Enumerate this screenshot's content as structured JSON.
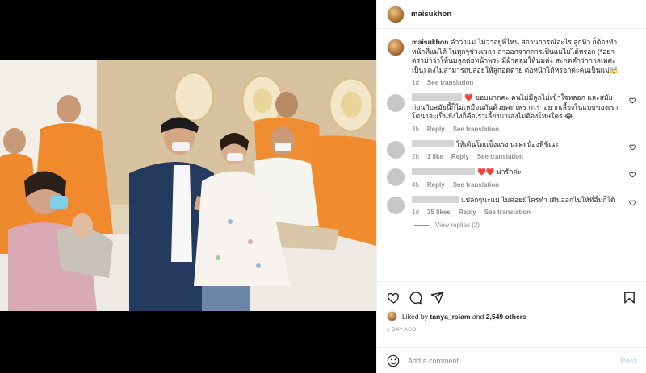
{
  "header": {
    "username": "maisukhon"
  },
  "caption": {
    "username": "maisukhon",
    "text": "คำว่าแม่ ไม่ว่าอยู่ที่ไหน สถานการณ์อะไร ลูกหิว ก็ต้องทำหน้าที่แม่ได้ ในทุกๆช่วงเวลา ลาออกจากการเป็นแม่ไม่ได้หรอก (*อย่าดราม่าว่าให้นมลูกต่อหน้าพระ มีผ้าคลุมให้นมค่ะ สะกดคำว่ากาลเทศะเป็น) คงไม่สามารถปล่อยให้ลูกอดตาย ต่อหน้าได้หรอกค่ะคนเป็นแม่🤯",
    "time": "1d",
    "translate": "See translation"
  },
  "comments": [
    {
      "text": "❤️ ขอบมากคะ คนไม่มีลูกไม่เข้าใจหลอก และสมัยก่อนกับสมัยนี้ก็ไม่เหมือนกันด้วยคะ เพราะเราอยากเลี้ยงในแบบของเรา โดนาจะเป็นยังไงก็คือเราเลี้ยงมาเองไม่ต้องโทษใคร 😂",
      "time": "3h",
      "reply": "Reply",
      "translate": "See translation",
      "likes": ""
    },
    {
      "text": "ให้เดินโดแข็งแรง นะคะน้องพี่ชิณะ",
      "time": "2h",
      "reply": "Reply",
      "translate": "See translation",
      "likes": "1 like"
    },
    {
      "text": "❤️❤️ น่ารักค่ะ",
      "time": "4h",
      "reply": "Reply",
      "translate": "See translation",
      "likes": ""
    },
    {
      "text": "แปลกๆนะแม่ ไม่ค่อยมีใครทำ เดินออกไปให้ที่อื่นก็ได้",
      "time": "1d",
      "reply": "Reply",
      "translate": "See translation",
      "likes": "35 likes"
    }
  ],
  "view_replies": "View replies (2)",
  "likes": {
    "prefix": "Liked by",
    "user": "tanya_rsiam",
    "and": "and",
    "count": "2,549 others"
  },
  "date": "1 DAY AGO",
  "add_comment": {
    "placeholder": "Add a comment...",
    "post_label": "Post"
  },
  "icons": [
    "heart-icon",
    "comment-icon",
    "share-icon",
    "bookmark-icon",
    "emoji-icon"
  ],
  "colors": {
    "link": "#b2dffc",
    "muted": "#8e8e8e",
    "red": "#ed4956"
  }
}
